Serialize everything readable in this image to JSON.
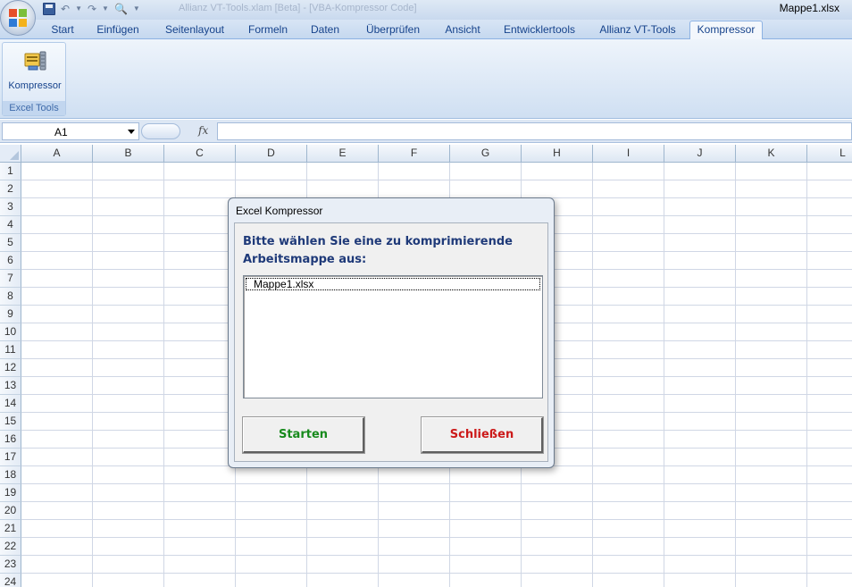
{
  "window": {
    "file_name": "Mappe1.xlsx",
    "faded_title": "Allianz VT-Tools.xlam [Beta] - [VBA-Kompressor Code]"
  },
  "tabs": [
    {
      "label": "Start",
      "active": false
    },
    {
      "label": "Einfügen",
      "active": false
    },
    {
      "label": "Seitenlayout",
      "active": false
    },
    {
      "label": "Formeln",
      "active": false
    },
    {
      "label": "Daten",
      "active": false
    },
    {
      "label": "Überprüfen",
      "active": false
    },
    {
      "label": "Ansicht",
      "active": false
    },
    {
      "label": "Entwicklertools",
      "active": false
    },
    {
      "label": "Allianz VT-Tools",
      "active": false
    },
    {
      "label": "Kompressor",
      "active": true
    }
  ],
  "ribbon": {
    "group_label": "Excel Tools",
    "button_label": "Kompressor",
    "button_icon": "compressor-icon"
  },
  "formula_bar": {
    "name_box": "A1",
    "fx": "fx",
    "formula": ""
  },
  "columns": [
    "A",
    "B",
    "C",
    "D",
    "E",
    "F",
    "G",
    "H",
    "I",
    "J",
    "K",
    "L"
  ],
  "rows": [
    "1",
    "2",
    "3",
    "4",
    "5",
    "6",
    "7",
    "8",
    "9",
    "10",
    "11",
    "12",
    "13",
    "14",
    "15",
    "16",
    "17",
    "18",
    "19",
    "20",
    "21",
    "22",
    "23",
    "24"
  ],
  "dialog": {
    "title": "Excel Kompressor",
    "prompt": "Bitte wählen Sie eine zu komprimierende Arbeitsmappe aus:",
    "list_items": [
      "Mappe1.xlsx"
    ],
    "start_label": "Starten",
    "close_label": "Schließen",
    "colors": {
      "prompt": "#1f3a79",
      "start": "#178a1c",
      "close": "#cc1a1a"
    }
  }
}
